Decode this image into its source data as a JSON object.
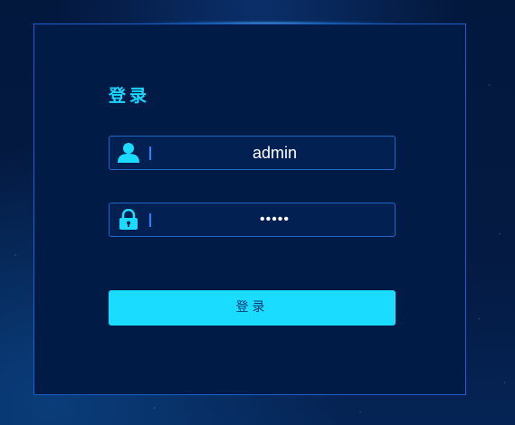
{
  "login": {
    "title": "登录",
    "username": {
      "value": "admin",
      "icon": "user-icon"
    },
    "password": {
      "value": "•••••",
      "icon": "lock-icon"
    },
    "submit_label": "登录"
  },
  "colors": {
    "accent": "#19dcff",
    "panel_bg": "#011b47",
    "border": "#1b5fd0"
  }
}
